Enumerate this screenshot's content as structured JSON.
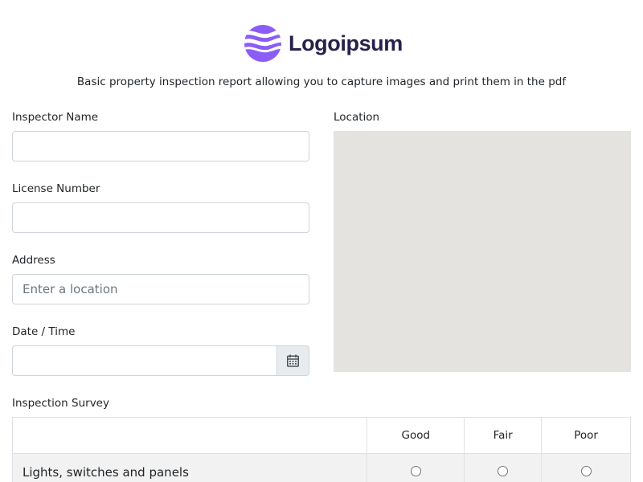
{
  "logo": {
    "text": "Logoipsum",
    "mark_color": "#8b5cf6",
    "text_color": "#27224a",
    "icon": "logo-wave-circle"
  },
  "subtitle": "Basic property inspection report allowing you to capture images and print them in the pdf",
  "form": {
    "inspector_name": {
      "label": "Inspector Name",
      "value": "",
      "placeholder": ""
    },
    "license_number": {
      "label": "License Number",
      "value": "",
      "placeholder": ""
    },
    "address": {
      "label": "Address",
      "value": "",
      "placeholder": "Enter a location"
    },
    "date_time": {
      "label": "Date / Time",
      "value": "",
      "placeholder": "",
      "icon": "calendar-icon"
    },
    "location": {
      "label": "Location"
    }
  },
  "survey": {
    "label": "Inspection Survey",
    "columns": [
      "",
      "Good",
      "Fair",
      "Poor"
    ],
    "rows": [
      {
        "label": "Lights, switches and panels"
      }
    ]
  }
}
